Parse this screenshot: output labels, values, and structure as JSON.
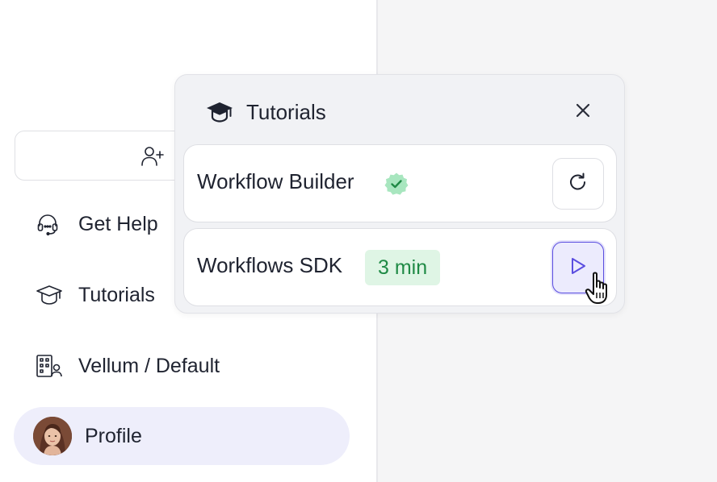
{
  "sidebar": {
    "invite_icon": "user-plus-icon",
    "items": [
      {
        "label": "Get Help",
        "icon": "headset-icon"
      },
      {
        "label": "Tutorials",
        "icon": "graduation-cap-icon"
      },
      {
        "label": "Vellum / Default",
        "icon": "building-user-icon"
      }
    ],
    "profile": {
      "label": "Profile",
      "icon": "avatar"
    }
  },
  "popover": {
    "title": "Tutorials",
    "title_icon": "graduation-cap-icon",
    "close_icon": "close-icon",
    "tutorials": [
      {
        "name": "Workflow Builder",
        "status": "completed",
        "status_icon": "check-badge-icon",
        "action_icon": "restart-icon"
      },
      {
        "name": "Workflows SDK",
        "duration": "3 min",
        "action_icon": "play-icon"
      }
    ]
  },
  "colors": {
    "accent": "#5b4ee0",
    "accent_bg": "#ecebfd",
    "success": "#1f8a45",
    "success_bg": "#dff5e5",
    "profile_bg": "#eeeefb"
  }
}
